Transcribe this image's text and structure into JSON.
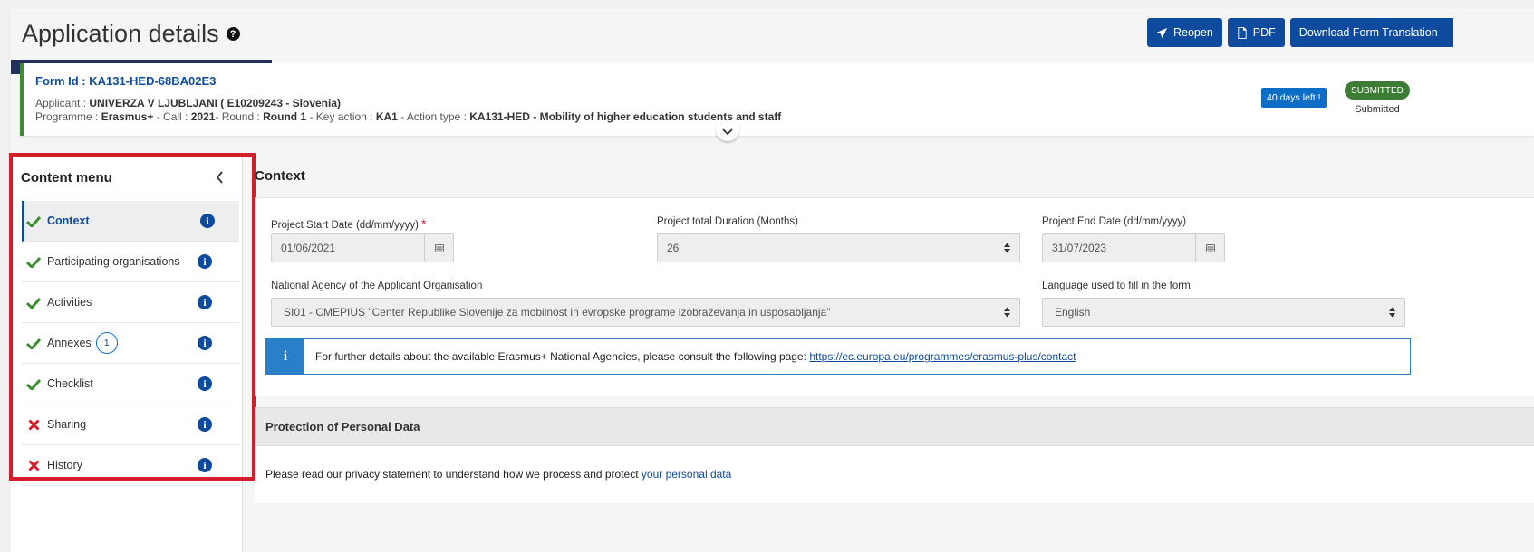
{
  "header": {
    "title": "Application details",
    "actions": {
      "reopen": "Reopen",
      "pdf": "PDF",
      "download": "Download Form Translation"
    }
  },
  "form": {
    "id_label": "Form Id : KA131-HED-68BA02E3",
    "applicant_prefix": "Applicant : ",
    "applicant_name": "UNIVERZA V LJUBLJANI ( E10209243 - Slovenia)",
    "programme_prefix": "Programme : ",
    "programme": "Erasmus+",
    "call_prefix": " - Call : ",
    "call": "2021",
    "round_prefix": "- Round : ",
    "round": "Round 1",
    "key_action_prefix": " - Key action : ",
    "key_action": "KA1",
    "action_type_prefix": " - Action type : ",
    "action_type": "KA131-HED - Mobility of higher education students and staff",
    "days_left": "40 days left !",
    "status_badge": "SUBMITTED",
    "status_text": "Submitted"
  },
  "sidebar": {
    "title": "Content menu",
    "items": [
      {
        "label": "Context",
        "status": "complete",
        "active": true
      },
      {
        "label": "Participating organisations",
        "status": "complete"
      },
      {
        "label": "Activities",
        "status": "complete"
      },
      {
        "label": "Annexes",
        "status": "complete",
        "badge": "1"
      },
      {
        "label": "Checklist",
        "status": "complete"
      },
      {
        "label": "Sharing",
        "status": "incomplete"
      },
      {
        "label": "History",
        "status": "incomplete"
      }
    ]
  },
  "context": {
    "title": "Context",
    "start_date_label": "Project Start Date (dd/mm/yyyy)",
    "start_date": "01/06/2021",
    "duration_label": "Project total Duration (Months)",
    "duration": "26",
    "end_date_label": "Project End Date (dd/mm/yyyy)",
    "end_date": "31/07/2023",
    "agency_label": "National Agency of the Applicant Organisation",
    "agency": "SI01 - CMEPIUS \"Center Republike Slovenije za mobilnost in evropske programe izobraževanja in usposabljanja\"",
    "language_label": "Language used to fill in the form",
    "language": "English",
    "info_text": "For further details about the available Erasmus+ National Agencies, please consult the following page: ",
    "info_link": "https://ec.europa.eu/programmes/erasmus-plus/contact"
  },
  "personal_data": {
    "title": "Protection of Personal Data",
    "text": "Please read our privacy statement to understand how we process and protect ",
    "link": "your personal data"
  },
  "colors": {
    "primary": "#0e4a9e",
    "success": "#3c8d2f",
    "danger": "#d41e2b",
    "info": "#2a7fc9"
  }
}
